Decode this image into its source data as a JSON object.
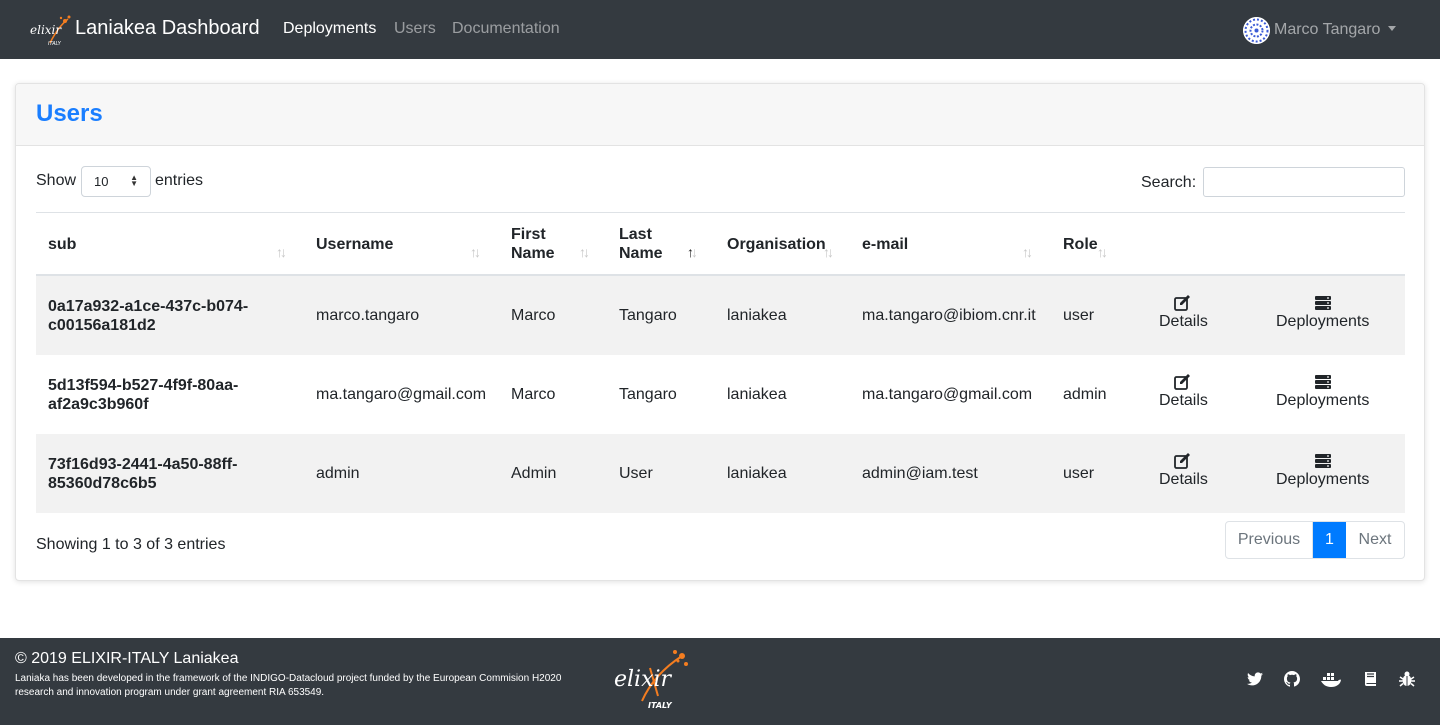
{
  "navbar": {
    "brand_title": "Laniakea Dashboard",
    "logo_text": "elixir",
    "logo_subtext": "ITALY",
    "links": [
      "Deployments",
      "Users",
      "Documentation"
    ],
    "active_link": "Deployments",
    "user_name": "Marco Tangaro"
  },
  "card": {
    "title": "Users",
    "show_label": "Show",
    "length_value": "10",
    "entries_label": "entries",
    "search_label": "Search:",
    "search_value": ""
  },
  "table": {
    "columns": [
      "sub",
      "Username",
      "First Name",
      "Last Name",
      "Organisation",
      "e-mail",
      "Role"
    ],
    "sorted_column": "Last Name",
    "sort_direction": "ascending",
    "rows": [
      {
        "sub": "0a17a932-a1ce-437c-b074-c00156a181d2",
        "username": "marco.tangaro",
        "first_name": "Marco",
        "last_name": "Tangaro",
        "organisation": "laniakea",
        "email": "ma.tangaro@ibiom.cnr.it",
        "role": "user",
        "details_label": "Details",
        "deployments_label": "Deployments"
      },
      {
        "sub": "5d13f594-b527-4f9f-80aa-af2a9c3b960f",
        "username": "ma.tangaro@gmail.com",
        "first_name": "Marco",
        "last_name": "Tangaro",
        "organisation": "laniakea",
        "email": "ma.tangaro@gmail.com",
        "role": "admin",
        "details_label": "Details",
        "deployments_label": "Deployments"
      },
      {
        "sub": "73f16d93-2441-4a50-88ff-85360d78c6b5",
        "username": "admin",
        "first_name": "Admin",
        "last_name": "User",
        "organisation": "laniakea",
        "email": "admin@iam.test",
        "role": "user",
        "details_label": "Details",
        "deployments_label": "Deployments"
      }
    ],
    "info": "Showing 1 to 3 of 3 entries",
    "pagination": {
      "previous": "Previous",
      "current": "1",
      "next": "Next"
    }
  },
  "footer": {
    "copyright": "© 2019 ELIXIR-ITALY Laniakea",
    "funding": "Laniaka has been developed in the framework of the INDIGO-Datacloud project funded by the European Commision H2020 research and innovation program under grant agreement RIA 653549.",
    "logo_text": "elixir",
    "logo_subtext": "ITALY",
    "social_icons": [
      "twitter-icon",
      "github-icon",
      "docker-icon",
      "book-icon",
      "bug-icon"
    ]
  },
  "colors": {
    "navbar_bg": "#343a40",
    "accent_blue": "#1a7eff",
    "pagination_active": "#007bff",
    "logo_orange": "#f47d20",
    "row_stripe": "#f2f2f2"
  }
}
